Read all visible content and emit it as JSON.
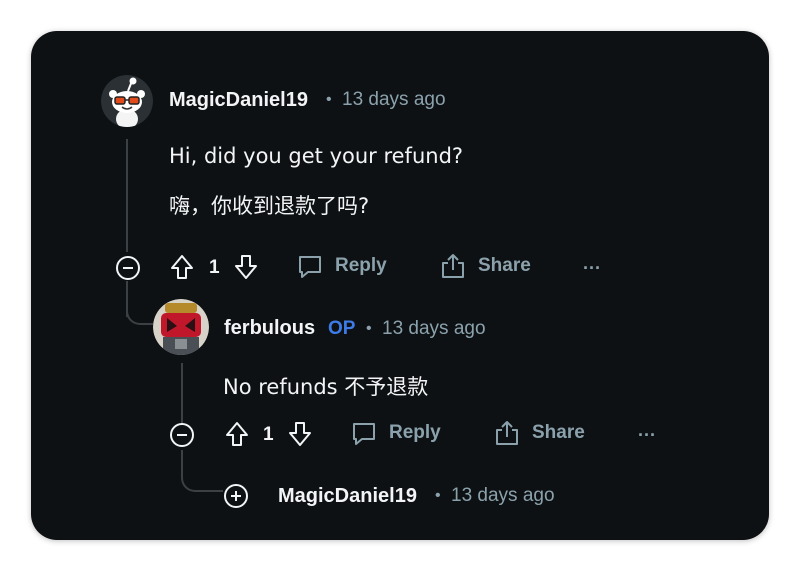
{
  "thread": {
    "comments": [
      {
        "author": "MagicDaniel19",
        "time": "13 days ago",
        "body": [
          "Hi, did you get your refund?",
          "嗨，你收到退款了吗?"
        ],
        "votes": "1",
        "actions": {
          "reply": "Reply",
          "share": "Share",
          "more": "···"
        }
      },
      {
        "author": "ferbulous",
        "badge": "OP",
        "time": "13 days ago",
        "body": [
          "No refunds  不予退款"
        ],
        "votes": "1",
        "actions": {
          "reply": "Reply",
          "share": "Share",
          "more": "···"
        }
      },
      {
        "author": "MagicDaniel19",
        "time": "13 days ago",
        "collapsed": true
      }
    ],
    "separator": "•",
    "colors": {
      "background": "#0e1113",
      "text": "#f2f4f5",
      "muted": "#8ba2ad",
      "op_badge": "#3d7be8",
      "thread_line": "#3a4044"
    }
  }
}
